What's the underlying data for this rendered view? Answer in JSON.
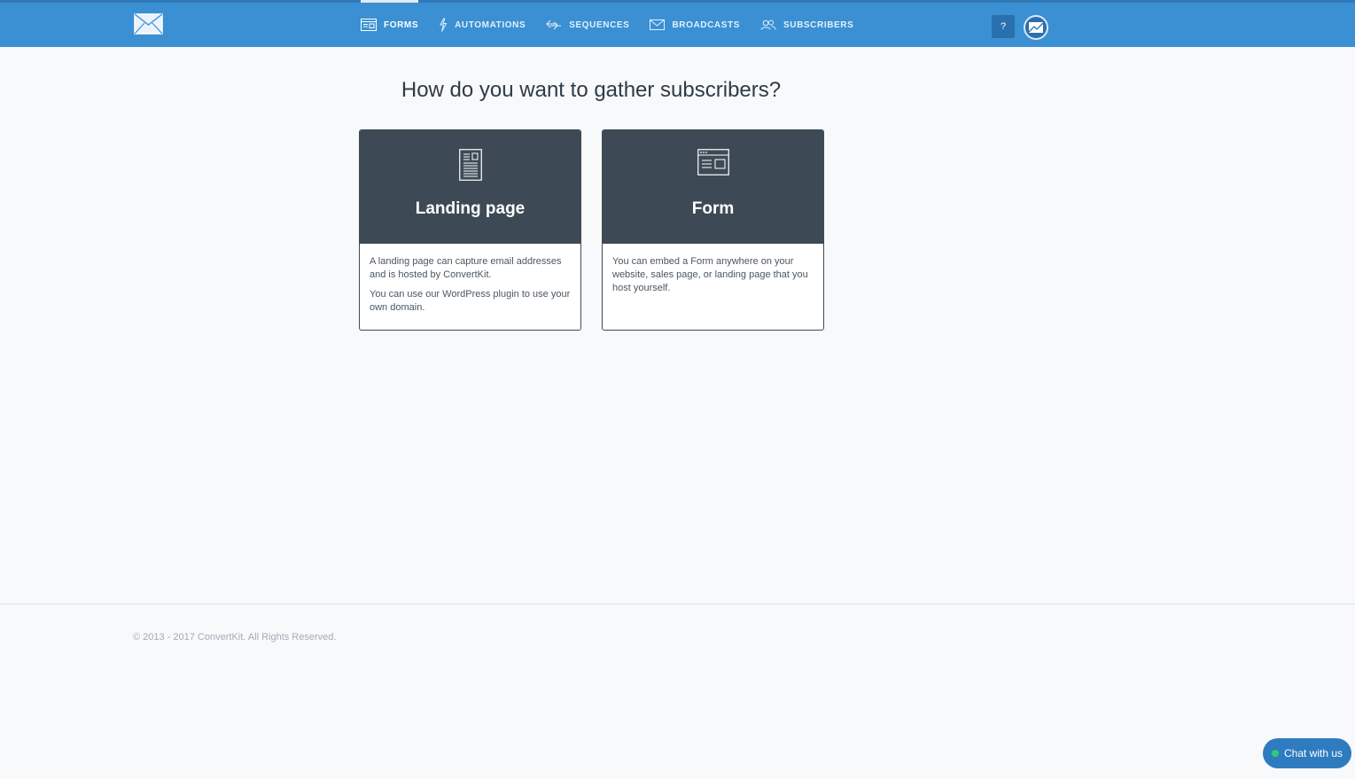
{
  "header": {
    "nav": [
      {
        "label": "FORMS",
        "icon": "forms-icon",
        "active": true
      },
      {
        "label": "AUTOMATIONS",
        "icon": "lightning-icon",
        "active": false
      },
      {
        "label": "SEQUENCES",
        "icon": "sequences-icon",
        "active": false
      },
      {
        "label": "BROADCASTS",
        "icon": "envelope-icon",
        "active": false
      },
      {
        "label": "SUBSCRIBERS",
        "icon": "users-icon",
        "active": false
      }
    ],
    "help_label": "?"
  },
  "main": {
    "title": "How do you want to gather subscribers?",
    "cards": [
      {
        "title": "Landing page",
        "icon": "landing-page-icon",
        "paragraphs": [
          "A landing page can capture email addresses and is hosted by ConvertKit.",
          "You can use our WordPress plugin to use your own domain."
        ]
      },
      {
        "title": "Form",
        "icon": "form-window-icon",
        "paragraphs": [
          "You can embed a Form anywhere on your website, sales page, or landing page that you host yourself."
        ]
      }
    ]
  },
  "footer": {
    "copyright": "© 2013 - 2017 ConvertKit. All Rights Reserved."
  },
  "chat": {
    "label": "Chat with us"
  },
  "colors": {
    "header_bg": "#3b90d3",
    "card_header_bg": "#3d4a55",
    "chat_bg": "#2f7bc0",
    "online_dot": "#2ecc71"
  }
}
